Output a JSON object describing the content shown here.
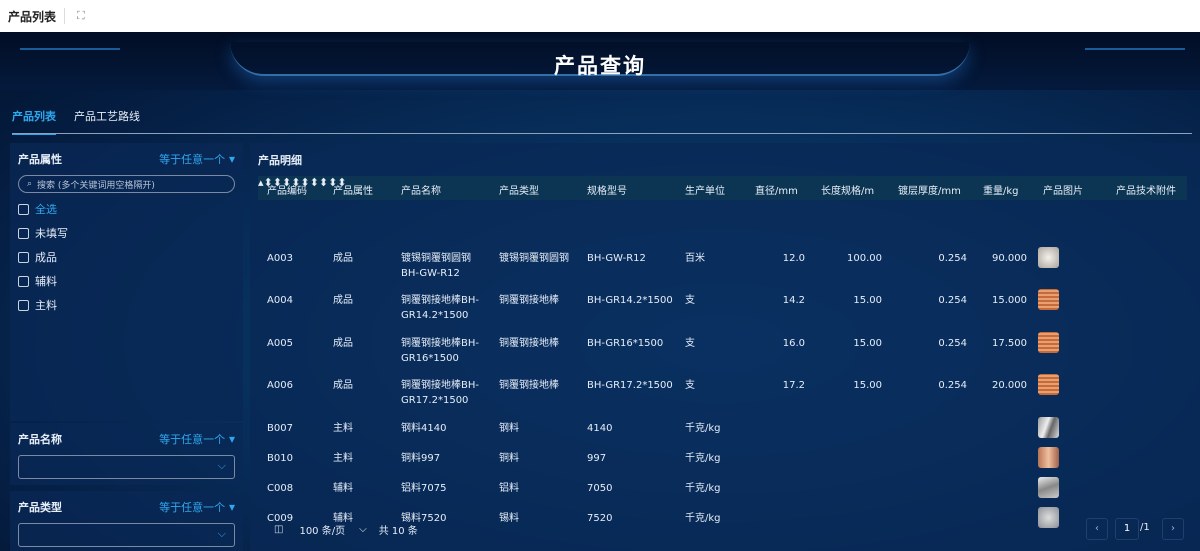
{
  "topbar": {
    "title": "产品列表",
    "fullscreen_icon": "expand-icon"
  },
  "header": {
    "title": "产品查询"
  },
  "tabs": [
    {
      "label": "产品列表",
      "active": true
    },
    {
      "label": "产品工艺路线",
      "active": false
    }
  ],
  "filters": {
    "attr": {
      "label": "产品属性",
      "op": "等于任意一个",
      "search_placeholder": "搜索 (多个关键词用空格隔开)",
      "options": [
        "全选",
        "未填写",
        "成品",
        "辅料",
        "主料"
      ]
    },
    "name": {
      "label": "产品名称",
      "op": "等于任意一个"
    },
    "type": {
      "label": "产品类型",
      "op": "等于任意一个"
    }
  },
  "table": {
    "title": "产品明细",
    "columns": [
      "产品编码",
      "产品属性",
      "产品名称",
      "产品类型",
      "规格型号",
      "生产单位",
      "直径/mm",
      "长度规格/m",
      "镀层厚度/mm",
      "重量/kg",
      "产品图片",
      "产品技术附件"
    ],
    "rows": [
      {
        "code": "A003",
        "attr": "成品",
        "name1": "镀锡铜覆钢圆钢",
        "name2": "BH-GW-R12",
        "type": "镀锡铜覆钢圆钢",
        "spec": "BH-GW-R12",
        "unit": "百米",
        "dia": "12.0",
        "len": "100.00",
        "thick": "0.254",
        "weight": "90.000",
        "img": "silver"
      },
      {
        "code": "A004",
        "attr": "成品",
        "name1": "铜覆钢接地棒BH-",
        "name2": "GR14.2*1500",
        "type": "铜覆钢接地棒",
        "spec": "BH-GR14.2*1500",
        "unit": "支",
        "dia": "14.2",
        "len": "15.00",
        "thick": "0.254",
        "weight": "15.000",
        "img": "copper"
      },
      {
        "code": "A005",
        "attr": "成品",
        "name1": "铜覆钢接地棒BH-",
        "name2": "GR16*1500",
        "type": "铜覆钢接地棒",
        "spec": "BH-GR16*1500",
        "unit": "支",
        "dia": "16.0",
        "len": "15.00",
        "thick": "0.254",
        "weight": "17.500",
        "img": "copper"
      },
      {
        "code": "A006",
        "attr": "成品",
        "name1": "铜覆钢接地棒BH-",
        "name2": "GR17.2*1500",
        "type": "铜覆钢接地棒",
        "spec": "BH-GR17.2*1500",
        "unit": "支",
        "dia": "17.2",
        "len": "15.00",
        "thick": "0.254",
        "weight": "20.000",
        "img": "copper"
      },
      {
        "code": "B007",
        "attr": "主料",
        "name1": "钢料4140",
        "name2": "",
        "type": "钢料",
        "spec": "4140",
        "unit": "千克/kg",
        "dia": "",
        "len": "",
        "thick": "",
        "weight": "",
        "img": "steel"
      },
      {
        "code": "B010",
        "attr": "主料",
        "name1": "铜料997",
        "name2": "",
        "type": "铜料",
        "spec": "997",
        "unit": "千克/kg",
        "dia": "",
        "len": "",
        "thick": "",
        "weight": "",
        "img": "cu"
      },
      {
        "code": "C008",
        "attr": "辅料",
        "name1": "铝料7075",
        "name2": "",
        "type": "铝料",
        "spec": "7050",
        "unit": "千克/kg",
        "dia": "",
        "len": "",
        "thick": "",
        "weight": "",
        "img": "al"
      },
      {
        "code": "C009",
        "attr": "辅料",
        "name1": "锡料7520",
        "name2": "",
        "type": "锡料",
        "spec": "7520",
        "unit": "千克/kg",
        "dia": "",
        "len": "",
        "thick": "",
        "weight": "",
        "img": "tin"
      }
    ]
  },
  "pager": {
    "page_size": "100 条/页",
    "total": "共 10 条",
    "current": "1",
    "pages": "/1"
  }
}
